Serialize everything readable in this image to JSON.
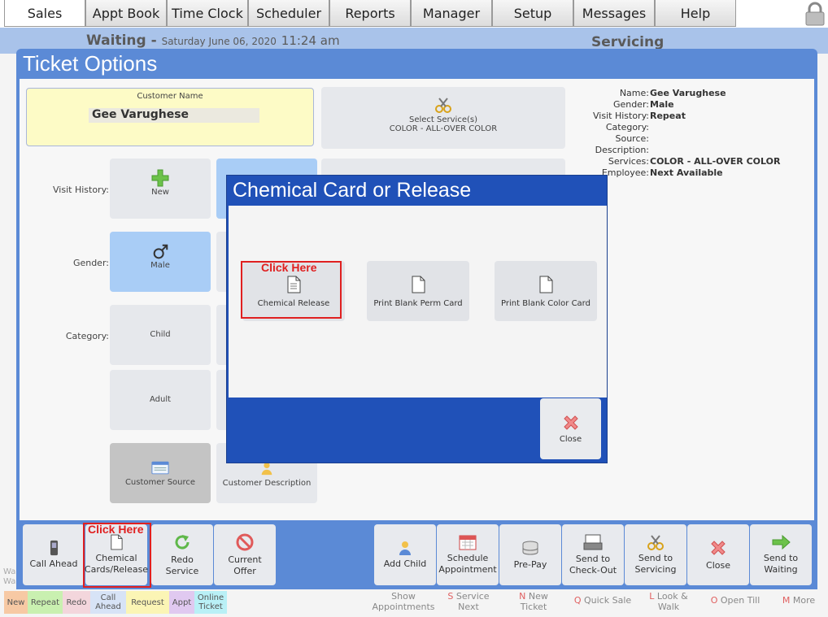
{
  "tabs": [
    "Sales",
    "Appt Book",
    "Time Clock",
    "Scheduler",
    "Reports",
    "Manager",
    "Setup",
    "Messages",
    "Help"
  ],
  "status": {
    "state": "Waiting -",
    "date": "Saturday June 06, 2020",
    "time": "11:24 am",
    "right": "Servicing"
  },
  "ticket": {
    "title": "Ticket Options",
    "customer_label": "Customer Name",
    "customer_name": "Gee Varughese",
    "service_label": "Select Service(s)",
    "service_value": "COLOR - ALL-OVER COLOR",
    "rows": {
      "visit_history": "Visit History:",
      "gender": "Gender:",
      "category": "Category:"
    },
    "tiles": {
      "new": "New",
      "male": "Male",
      "child": "Child",
      "adult": "Adult",
      "customer_source": "Customer Source",
      "customer_description": "Customer Description"
    },
    "info": [
      {
        "k": "Name:",
        "v": "Gee Varughese"
      },
      {
        "k": "Gender:",
        "v": "Male"
      },
      {
        "k": "Visit History:",
        "v": "Repeat"
      },
      {
        "k": "Category:",
        "v": ""
      },
      {
        "k": "Source:",
        "v": ""
      },
      {
        "k": "Description:",
        "v": ""
      },
      {
        "k": "Services:",
        "v": "COLOR - ALL-OVER COLOR"
      },
      {
        "k": "Employee:",
        "v": "Next Available"
      }
    ]
  },
  "modal": {
    "title": "Chemical Card or Release",
    "click_here": "Click Here",
    "chemical_release": "Chemical Release",
    "print_perm": "Print Blank Perm Card",
    "print_color": "Print Blank Color Card",
    "close": "Close"
  },
  "toolbar": {
    "click_here": "Click Here",
    "call_ahead": "Call Ahead",
    "chemical_1": "Chemical",
    "chemical_2": "Cards/Release",
    "redo_1": "Redo",
    "redo_2": "Service",
    "offer_1": "Current",
    "offer_2": "Offer",
    "add_child": "Add Child",
    "schedule_1": "Schedule",
    "schedule_2": "Appointment",
    "prepay": "Pre-Pay",
    "checkout_1": "Send to",
    "checkout_2": "Check-Out",
    "servicing_1": "Send to",
    "servicing_2": "Servicing",
    "close": "Close",
    "waiting_1": "Send to",
    "waiting_2": "Waiting"
  },
  "legend": {
    "new": "New",
    "repeat": "Repeat",
    "redo": "Redo",
    "call_1": "Call",
    "call_2": "Ahead",
    "request": "Request",
    "appt": "Appt",
    "online_1": "Online",
    "online_2": "Ticket"
  },
  "legend_colors": {
    "new": "#f7c9a4",
    "repeat": "#c9f0b0",
    "redo": "#f3d6dc",
    "call": "#d7e3f6",
    "request": "#fbf5b5",
    "appt": "#e0c9f0",
    "online": "#b9f0f6"
  },
  "shortcuts": {
    "show_1": "Show",
    "show_2": "Appointments",
    "s_key": "S",
    "s_1": "Service",
    "s_2": "Next",
    "n_key": "N",
    "n_1": "New",
    "n_2": "Ticket",
    "q_key": "Q",
    "q": "Quick Sale",
    "l_key": "L",
    "l_1": "Look &",
    "l_2": "Walk",
    "o_key": "O",
    "o": "Open Till",
    "m_key": "M",
    "m": "More"
  },
  "behind": {
    "wa_1": "Wa",
    "wa_2": "Wa"
  },
  "colors": {
    "accent": "#5b8ad6",
    "modal": "#2051b8",
    "highlight": "#e02020",
    "selected": "#a9cdf6"
  }
}
